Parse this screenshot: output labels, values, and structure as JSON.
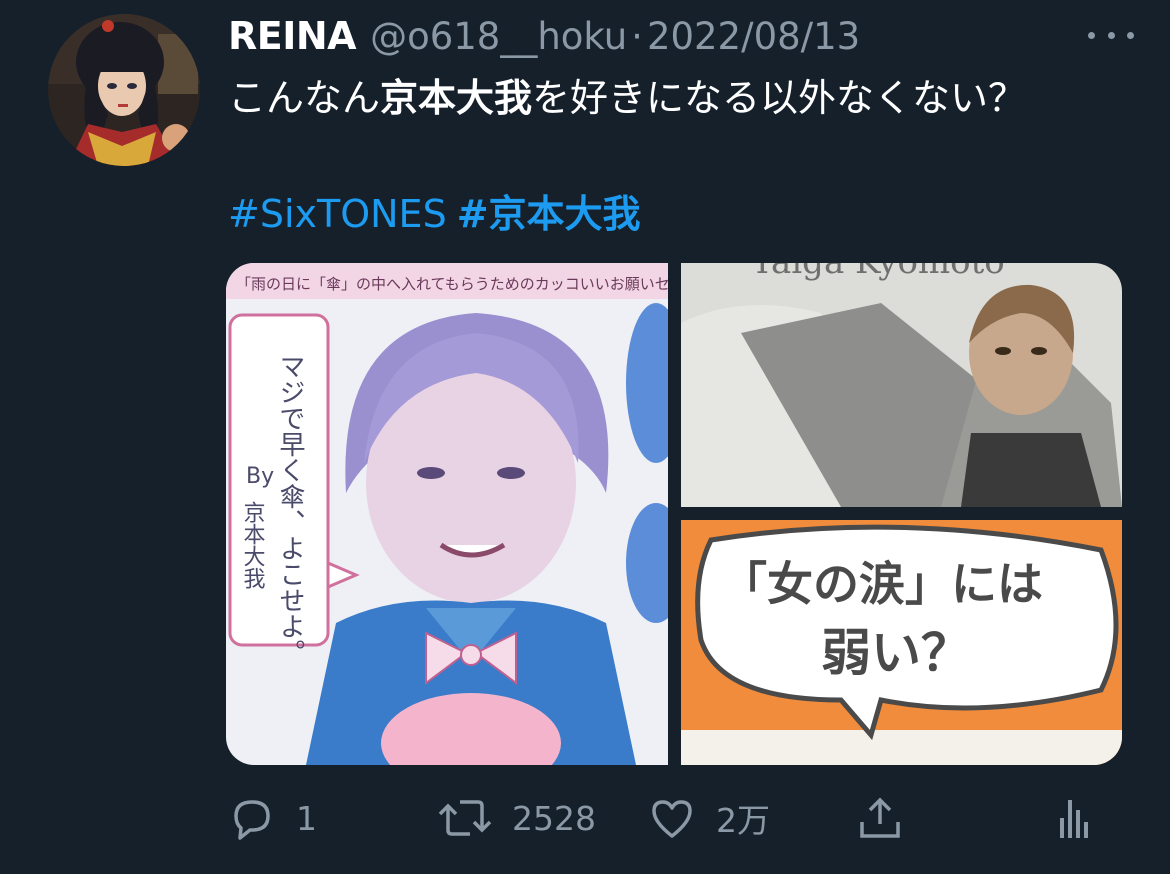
{
  "tweet": {
    "display_name": "REINA",
    "handle": "@o618__hoku",
    "separator": "·",
    "date": "2022/08/13",
    "text_before": "こんなん",
    "text_bold": "京本大我",
    "text_after": "を好きになる以外なくない？",
    "hashtags": [
      "#SixTONES",
      "#京本大我"
    ]
  },
  "media": {
    "left_caption_top": "「雨の日に「傘」の中へ入れてもらうためのカッコいいお願いセリフ」",
    "left_bubble_text": "マジで早く傘、よこせよ。",
    "left_by": "By",
    "left_by_name": "京本大我",
    "top_right_caption": "Taiga Kyomoto",
    "bottom_right_text_1": "「女の涙」には",
    "bottom_right_text_2": "弱い？"
  },
  "actions": {
    "reply_count": "1",
    "retweet_count": "2528",
    "like_count": "2万"
  },
  "colors": {
    "background": "#15202b",
    "text": "#ffffff",
    "secondary": "#8b98a5",
    "accent": "#1d9bf0"
  },
  "icons": {
    "reply": "reply-icon",
    "retweet": "retweet-icon",
    "like": "heart-icon",
    "share": "share-icon",
    "analytics": "analytics-icon",
    "more": "more-icon"
  }
}
